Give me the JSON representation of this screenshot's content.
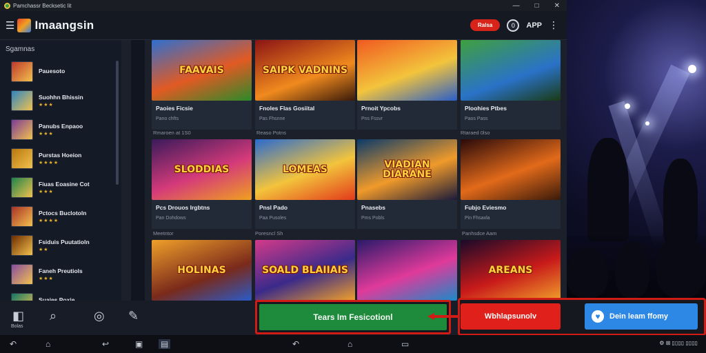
{
  "window": {
    "title": "Pamchassr Becksetic lit",
    "controls": [
      "—",
      "□",
      "✕"
    ]
  },
  "header": {
    "brand": "Imaangsin",
    "pill_label": "Ralsa",
    "round_label": "0",
    "app_label": "APP",
    "menu_glyph": "⋮"
  },
  "sidebar": {
    "title": "Sgamnas",
    "items": [
      {
        "name": "Pauesoto",
        "green": false,
        "stars": ""
      },
      {
        "name": "Suohhn Bhissin",
        "green": true,
        "stars": "★★★"
      },
      {
        "name": "Panubs Enpaoo",
        "green": false,
        "stars": "★★★"
      },
      {
        "name": "Purstas Hoeion",
        "green": false,
        "stars": "★★★★"
      },
      {
        "name": "Fiuas Eoasine Cot",
        "green": true,
        "stars": "★★★"
      },
      {
        "name": "Pctocs Buclotoln",
        "green": false,
        "stars": "★★★★"
      },
      {
        "name": "Fsiduis Puutatioln",
        "green": false,
        "stars": "★★"
      },
      {
        "name": "Faneh Preutiols",
        "green": false,
        "stars": "★★★"
      },
      {
        "name": "Suaies Poxie",
        "green": false,
        "stars": "★★★"
      }
    ]
  },
  "grid": {
    "row_labels": [
      "Rmaroen at 1S0",
      "Reaso Potns",
      "Rtaraed 0lso",
      "Panhsdce Aam",
      "Poresncl Sh",
      "Meetntor"
    ],
    "games": [
      {
        "art": "FAAVAIS",
        "title": "Paoies Ficsie",
        "sub": "Pano chfts"
      },
      {
        "art": "SAIPK VADNINS",
        "title": "Fnoles Flas Gosiital",
        "sub": "Pas Fhsnne"
      },
      {
        "art": "",
        "title": "Prnoit Ypcobs",
        "sub": "Pns Fssvr"
      },
      {
        "art": "",
        "title": "Ploohies Ptbes",
        "sub": "Paos Pass"
      },
      {
        "art": "SLODDIAS",
        "title": "Pcs Drouos Irgbtns",
        "sub": "Pan Dohdows"
      },
      {
        "art": "LOMEAS",
        "title": "Pnsl Pado",
        "sub": "Paa Pusoles"
      },
      {
        "art": "VIADIAN DIARANE",
        "title": "Pnasebs",
        "sub": "Pms Pobls"
      },
      {
        "art": "",
        "title": "Fubjo Eviesmo",
        "sub": "Pin Fhsaxla"
      },
      {
        "art": "HOLINAS",
        "title": "",
        "sub": ""
      },
      {
        "art": "SOALD BLAIIAIS",
        "title": "",
        "sub": ""
      },
      {
        "art": "",
        "title": "",
        "sub": ""
      },
      {
        "art": "AREANS",
        "title": "",
        "sub": ""
      }
    ]
  },
  "appbar": {
    "home_label": "Bolas"
  },
  "cta": {
    "green_label": "Tears Im Fesicotionl",
    "red_label": "Wbhlapsunolv",
    "blue_label": "Dein leam ffomy"
  },
  "statusbar": {
    "right_text": "⚙ ⊞ ▯▯▯▯ ▯▯▯▯"
  },
  "colors": {
    "accent_red": "#d01c14",
    "green_button": "#1e8a3c",
    "blue_button": "#2d87e4",
    "pill_red": "#d8231b"
  }
}
